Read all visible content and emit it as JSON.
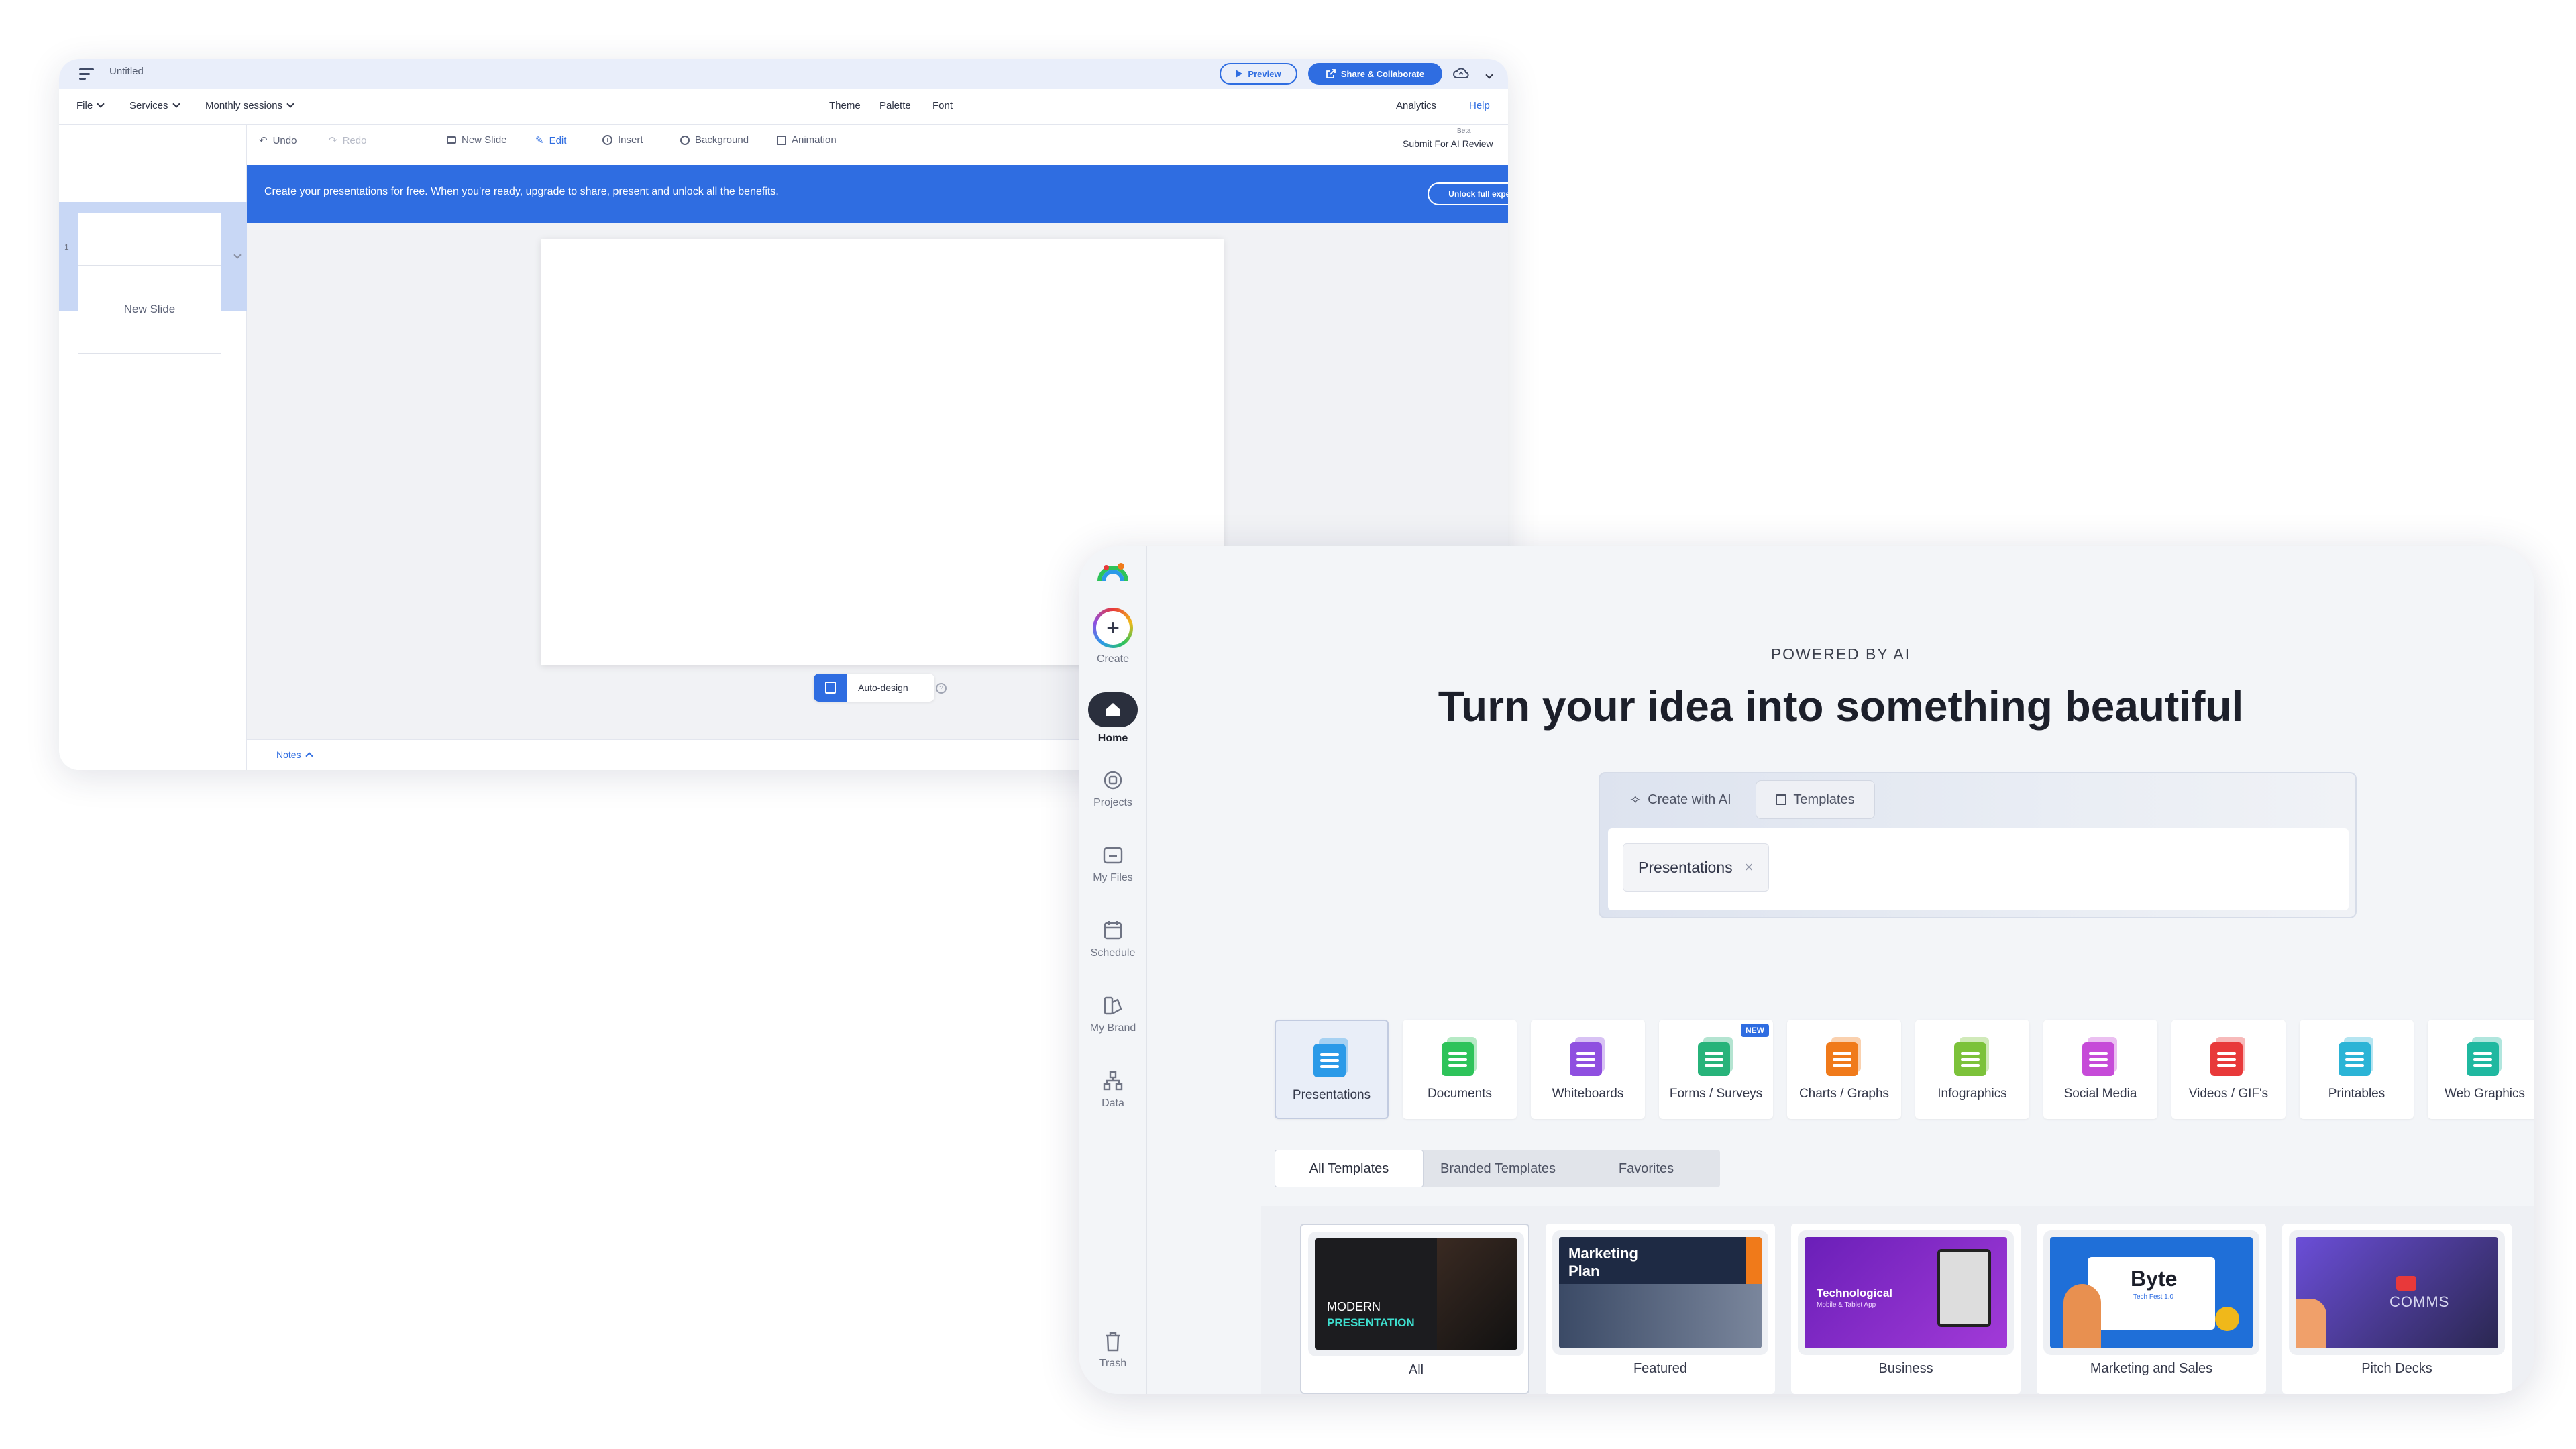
{
  "editor": {
    "doc_title": "Untitled",
    "preview_label": "Preview",
    "share_label": "Share & Collaborate",
    "menus": [
      "File",
      "Services",
      "Monthly sessions"
    ],
    "center_menus": [
      "Theme",
      "Palette",
      "Font"
    ],
    "analytics_label": "Analytics",
    "help_label": "Help",
    "toolbar": {
      "undo": "Undo",
      "redo": "Redo",
      "new_slide": "New Slide",
      "edit": "Edit",
      "insert": "Insert",
      "background": "Background",
      "animation": "Animation"
    },
    "beta_label": "Beta",
    "submit_ai": "Submit For AI Review",
    "slide_number": "1",
    "new_slide_thumb": "New Slide",
    "banner_text": "Create your presentations for free. When you're ready, upgrade to share, present and unlock all the benefits.",
    "unlock_label": "Unlock full experience",
    "auto_design_label": "Auto-design",
    "notes_label": "Notes",
    "colors": {
      "accent": "#2f6de1",
      "selection": "#c8d7f5",
      "canvas_bg": "#f1f2f5"
    }
  },
  "dashboard": {
    "nav": {
      "create": "Create",
      "home": "Home",
      "projects": "Projects",
      "my_files": "My Files",
      "schedule": "Schedule",
      "my_brand": "My Brand",
      "data": "Data",
      "trash": "Trash"
    },
    "powered_by": "POWERED BY AI",
    "headline": "Turn your idea into something beautiful",
    "tabs": {
      "create_ai": "Create with AI",
      "templates": "Templates"
    },
    "chip_label": "Presentations",
    "categories": [
      {
        "label": "Presentations",
        "icon": "presentation-icon",
        "color": "#2b9ae8"
      },
      {
        "label": "Documents",
        "icon": "document-icon",
        "color": "#2ec35a"
      },
      {
        "label": "Whiteboards",
        "icon": "whiteboard-icon",
        "color": "#8f4fe0"
      },
      {
        "label": "Forms / Surveys",
        "icon": "form-icon",
        "color": "#27b37a",
        "badge": "NEW"
      },
      {
        "label": "Charts / Graphs",
        "icon": "chart-icon",
        "color": "#f07a1a"
      },
      {
        "label": "Infographics",
        "icon": "infographic-icon",
        "color": "#7cc23a"
      },
      {
        "label": "Social Media",
        "icon": "social-icon",
        "color": "#c64bd8"
      },
      {
        "label": "Videos / GIF's",
        "icon": "video-icon",
        "color": "#e8393a"
      },
      {
        "label": "Printables",
        "icon": "printer-icon",
        "color": "#2bb4d6"
      },
      {
        "label": "Web Graphics",
        "icon": "web-icon",
        "color": "#1fb8a0"
      }
    ],
    "template_tabs": [
      "All Templates",
      "Branded Templates",
      "Favorites"
    ],
    "template_cards": [
      {
        "label": "All",
        "thumb_line1": "MODERN",
        "thumb_line2": "PRESENTATION"
      },
      {
        "label": "Featured",
        "thumb_line1": "Marketing",
        "thumb_line2": "Plan"
      },
      {
        "label": "Business",
        "thumb_line1": "Technological",
        "thumb_line2": "Mobile & Tablet App"
      },
      {
        "label": "Marketing and Sales",
        "thumb_line1": "Byte",
        "thumb_line2": "Tech Fest 1.0"
      },
      {
        "label": "Pitch Decks",
        "thumb_line1": "COMMS",
        "thumb_line2": ""
      }
    ]
  }
}
